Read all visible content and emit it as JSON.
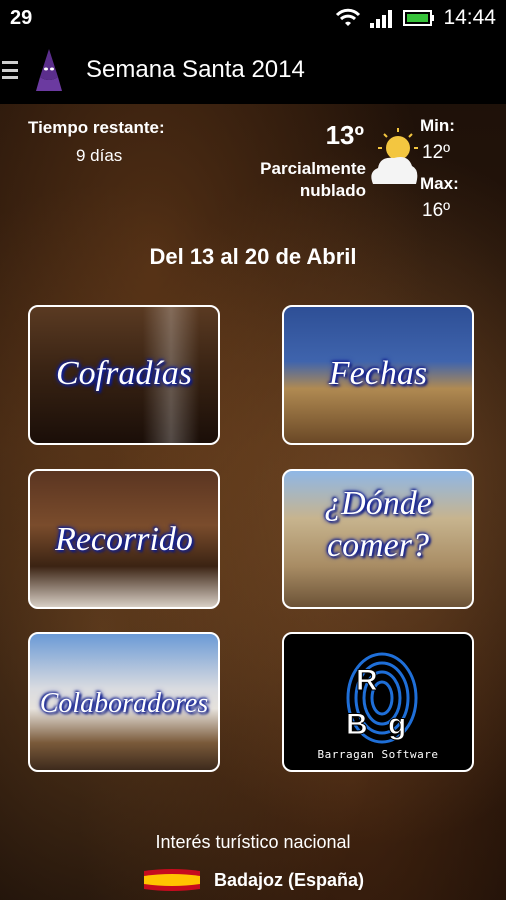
{
  "status": {
    "left_text": "29",
    "time": "14:44"
  },
  "app": {
    "title": "Semana Santa 2014"
  },
  "info": {
    "remaining_title": "Tiempo restante:",
    "remaining_value": "9 días",
    "temperature": "13º",
    "weather_desc_line1": "Parcialmente",
    "weather_desc_line2": "nublado",
    "min_label": "Min:",
    "min_value": "12º",
    "max_label": "Max:",
    "max_value": "16º"
  },
  "date_range": "Del 13 al 20 de Abril",
  "tiles": [
    {
      "label": "Cofradías"
    },
    {
      "label": "Fechas"
    },
    {
      "label": "Recorrido"
    },
    {
      "label_line1": "¿Dónde",
      "label_line2": "comer?"
    },
    {
      "label": "Colaboradores"
    },
    {
      "logo_text": "RBg",
      "caption": "Barragan Software"
    }
  ],
  "footer": {
    "line1": "Interés turístico nacional",
    "line2": "Badajoz (España)"
  },
  "colors": {
    "accent_text_shadow": "#1a2aa8",
    "status_bar": "#000000",
    "battery": "#37c23a"
  },
  "icons": [
    "menu-icon",
    "app-logo-icon",
    "wifi-icon",
    "signal-icon",
    "battery-icon",
    "weather-partly-cloudy-icon",
    "spain-flag-icon",
    "barragan-fingerprint-logo"
  ]
}
